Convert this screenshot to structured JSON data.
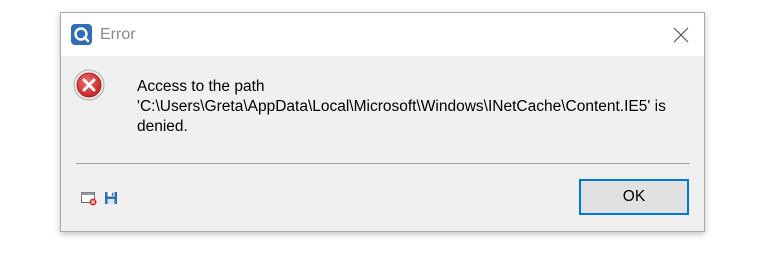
{
  "window": {
    "title": "Error",
    "app_icon": "app-logo-icon",
    "close_icon": "close-icon"
  },
  "message": {
    "icon": "error-x-icon",
    "text": "Access to the path\n'C:\\Users\\Greta\\AppData\\Local\\Microsoft\\Windows\\INetCache\\Content.IE5' is\ndenied."
  },
  "footer": {
    "icons": [
      "window-error-icon",
      "save-icon"
    ],
    "ok_label": "OK"
  },
  "colors": {
    "accent": "#0078d7",
    "error_red": "#d93030",
    "dialog_bg": "#f0f0f0"
  }
}
